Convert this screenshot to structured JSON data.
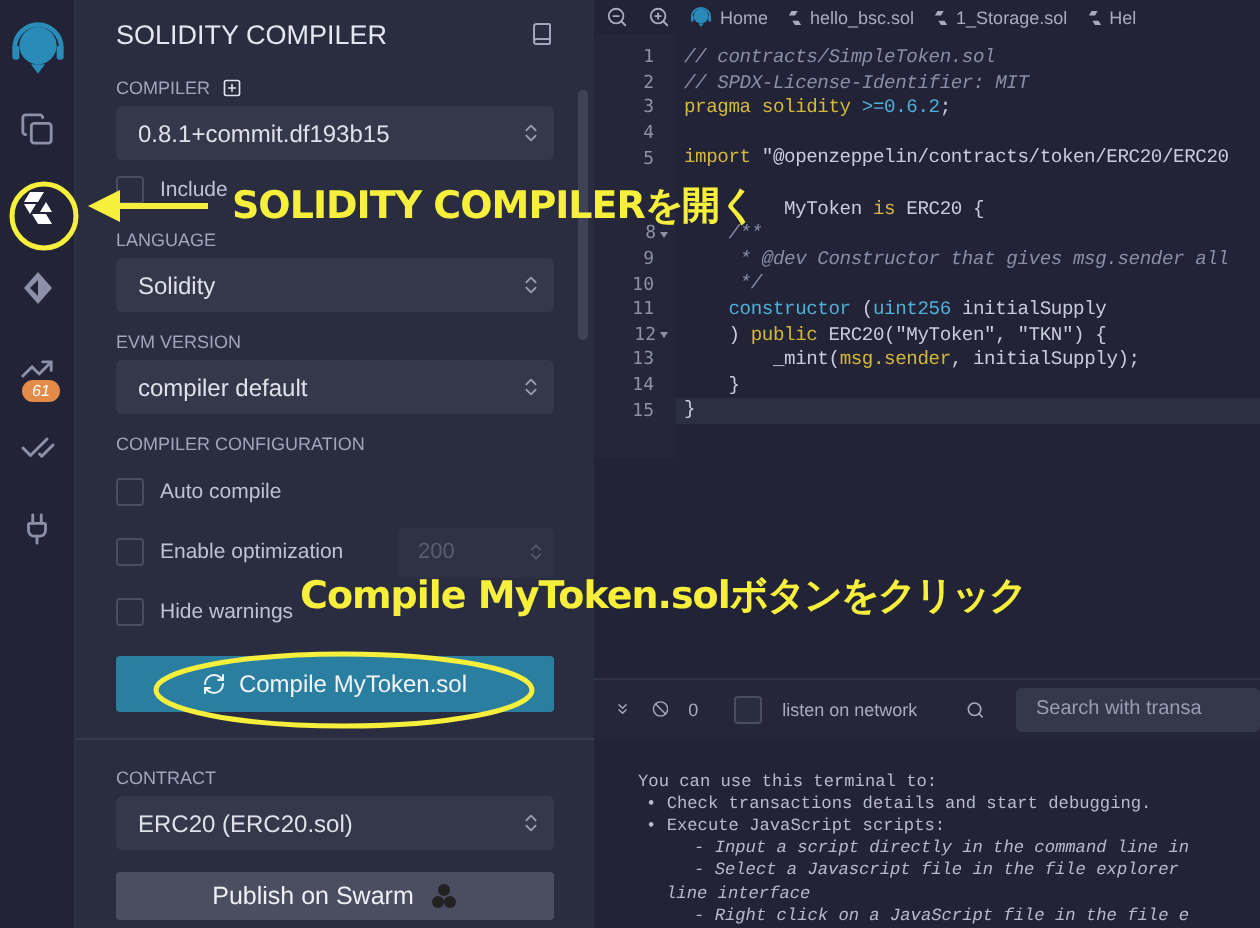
{
  "icon_bar": {
    "items": [
      {
        "kind": "files",
        "selected": false
      },
      {
        "kind": "solidity",
        "selected": true
      },
      {
        "kind": "deploy",
        "selected": false
      },
      {
        "kind": "analysis",
        "selected": false,
        "badge": "61"
      },
      {
        "kind": "tests",
        "selected": false
      },
      {
        "kind": "plugins",
        "selected": false
      }
    ]
  },
  "sidebar": {
    "title": "SOLIDITY COMPILER",
    "compiler": {
      "label": "COMPILER",
      "value": "0.8.1+commit.df193b15"
    },
    "nightly": {
      "label": "Include",
      "checked": false
    },
    "language": {
      "label": "LANGUAGE",
      "value": "Solidity"
    },
    "evm": {
      "label": "EVM VERSION",
      "value": "compiler default"
    },
    "config": {
      "label": "COMPILER CONFIGURATION",
      "options": [
        {
          "label": "Auto compile",
          "checked": false
        },
        {
          "label": "Enable optimization",
          "checked": false,
          "runs": "200"
        },
        {
          "label": "Hide warnings",
          "checked": false
        }
      ]
    },
    "compile_button": "Compile MyToken.sol",
    "contract": {
      "label": "CONTRACT",
      "value": "ERC20 (ERC20.sol)"
    },
    "publish_button": "Publish on Swarm"
  },
  "editor": {
    "tabs": [
      {
        "label": "Home",
        "kind": "home",
        "selected": false
      },
      {
        "label": "hello_bsc.sol",
        "kind": "file",
        "selected": false
      },
      {
        "label": "1_Storage.sol",
        "kind": "file",
        "selected": false
      },
      {
        "label": "Hel",
        "kind": "file",
        "selected": false
      }
    ],
    "lines": [
      {
        "number": "1",
        "foldable": false,
        "active": false,
        "segments": [
          {
            "kind": "comment",
            "text": "// contracts/SimpleToken.sol"
          }
        ]
      },
      {
        "number": "2",
        "foldable": false,
        "active": false,
        "segments": [
          {
            "kind": "comment",
            "text": "// SPDX-License-Identifier: MIT"
          }
        ]
      },
      {
        "number": "3",
        "foldable": false,
        "active": false,
        "segments": [
          {
            "kind": "keyword",
            "text": "pragma solidity"
          },
          {
            "kind": "type",
            "text": " >=0.6.2"
          },
          {
            "kind": "plain",
            "text": ";"
          }
        ]
      },
      {
        "number": "4",
        "foldable": false,
        "active": false
      },
      {
        "number": "5",
        "foldable": false,
        "active": false,
        "segments": [
          {
            "kind": "keyword",
            "text": "import"
          },
          {
            "kind": "plain",
            "text": " \"@openzeppelin/contracts/token/ERC20/ERC20"
          }
        ]
      },
      {
        "foldable": false,
        "active": false
      },
      {
        "foldable": false,
        "active": false,
        "partly_covered": true,
        "segments": [
          {
            "kind": "plain",
            "text": "MyToken "
          },
          {
            "kind": "keyword",
            "text": "is"
          },
          {
            "kind": "plain",
            "text": " ERC20 {"
          }
        ]
      },
      {
        "number": "8",
        "foldable": true,
        "active": false,
        "segments": [
          {
            "kind": "comment",
            "text": "    /**"
          }
        ]
      },
      {
        "number": "9",
        "foldable": false,
        "active": false,
        "segments": [
          {
            "kind": "comment",
            "text": "     * @dev Constructor that gives msg.sender all"
          }
        ]
      },
      {
        "number": "10",
        "foldable": false,
        "active": false,
        "segments": [
          {
            "kind": "comment",
            "text": "     */"
          }
        ]
      },
      {
        "number": "11",
        "foldable": false,
        "active": false,
        "segments": [
          {
            "kind": "type",
            "text": "    constructor"
          },
          {
            "kind": "plain",
            "text": " ("
          },
          {
            "kind": "type",
            "text": "uint256"
          },
          {
            "kind": "plain",
            "text": " initialSupply"
          }
        ]
      },
      {
        "number": "12",
        "foldable": true,
        "active": false,
        "segments": [
          {
            "kind": "plain",
            "text": "    ) "
          },
          {
            "kind": "keyword",
            "text": "public"
          },
          {
            "kind": "plain",
            "text": " ERC20(\"MyToken\", \"TKN\") {"
          }
        ]
      },
      {
        "number": "13",
        "foldable": false,
        "active": false,
        "segments": [
          {
            "kind": "plain",
            "text": "        _mint("
          },
          {
            "kind": "keyword",
            "text": "msg.sender"
          },
          {
            "kind": "plain",
            "text": ", initialSupply);"
          }
        ]
      },
      {
        "number": "14",
        "foldable": false,
        "active": false,
        "segments": [
          {
            "kind": "plain",
            "text": "    }"
          }
        ]
      },
      {
        "number": "15",
        "foldable": false,
        "active": true,
        "segments": [
          {
            "kind": "plain",
            "text": "}"
          }
        ]
      }
    ]
  },
  "terminal": {
    "count": "0",
    "listen": {
      "label": "listen on network",
      "checked": false
    },
    "search": {
      "placeholder": "Search with transa"
    },
    "lines": [
      {
        "kind": "plain",
        "text": "You can use this terminal to:"
      },
      {
        "kind": "bullet",
        "text": "• Check transactions details and start debugging."
      },
      {
        "kind": "bullet",
        "text": "• Execute JavaScript scripts:"
      },
      {
        "kind": "sub",
        "text": "- Input a script directly in the command line in"
      },
      {
        "kind": "sub",
        "text": "- Select a Javascript file in the file explorer"
      },
      {
        "kind": "cont",
        "text": "line interface"
      },
      {
        "kind": "sub",
        "text": "- Right click on a JavaScript file in the file e"
      }
    ]
  },
  "annotations": [
    {
      "kind": "arrow",
      "text": "SOLIDITY COMPILERを開く"
    },
    {
      "kind": "ellipse",
      "text": "Compile MyToken.solボタンをクリック"
    }
  ]
}
